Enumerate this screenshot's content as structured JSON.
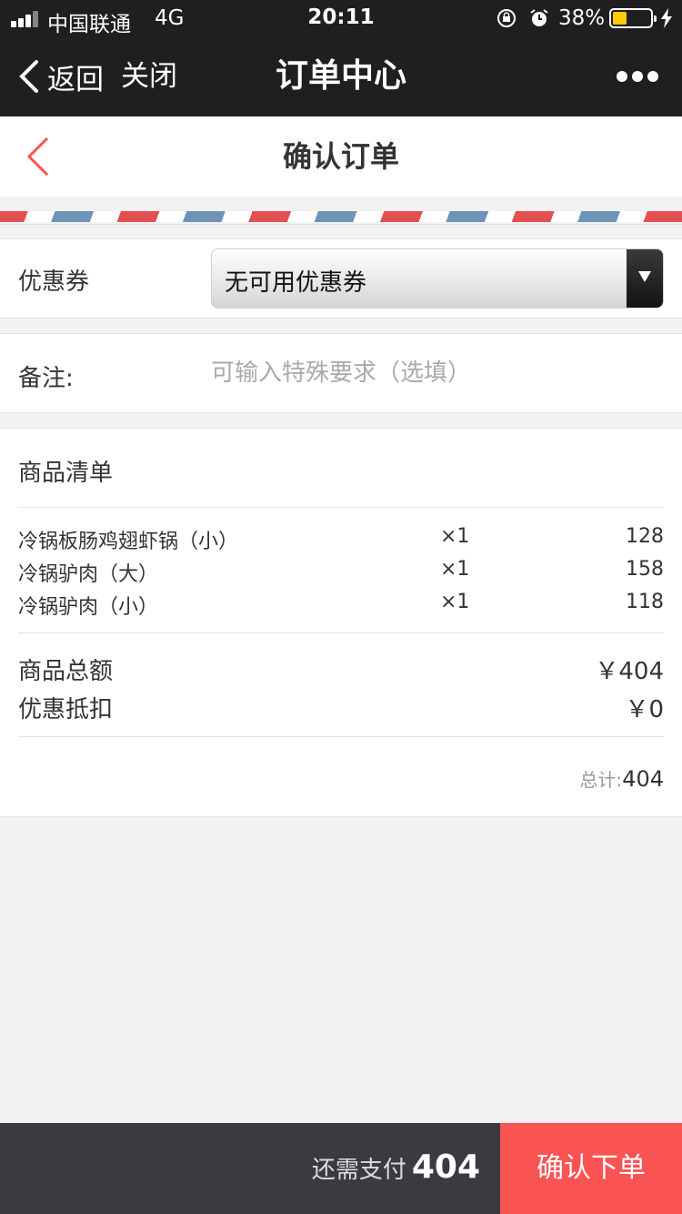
{
  "status_bar": {
    "carrier": "中国联通",
    "network": "4G",
    "time": "20:11",
    "battery_percent": "38%",
    "battery_level": 0.38,
    "battery_color": "#ffcc00"
  },
  "wechat_bar": {
    "back_label": "返回",
    "close_label": "关闭",
    "title": "订单中心",
    "more_icon": "more-dots-icon"
  },
  "page": {
    "title": "确认订单",
    "back_icon": "chevron-left-icon",
    "accent_color": "#f95354"
  },
  "coupon": {
    "label": "优惠券",
    "selected": "无可用优惠券"
  },
  "remark": {
    "label": "备注:",
    "placeholder": "可输入特殊要求（选填）"
  },
  "goods": {
    "heading": "商品清单",
    "items": [
      {
        "name": "冷锅板肠鸡翅虾锅（小）",
        "qty": "×1",
        "price": "128"
      },
      {
        "name": "冷锅驴肉（大）",
        "qty": "×1",
        "price": "158"
      },
      {
        "name": "冷锅驴肉（小）",
        "qty": "×1",
        "price": "118"
      }
    ],
    "subtotal_label": "商品总额",
    "subtotal_value": "￥404",
    "discount_label": "优惠抵扣",
    "discount_value": "￥0",
    "total_label": "总计:",
    "total_value": "404"
  },
  "footer": {
    "due_label": "还需支付",
    "due_value": "404",
    "confirm_label": "确认下单"
  }
}
